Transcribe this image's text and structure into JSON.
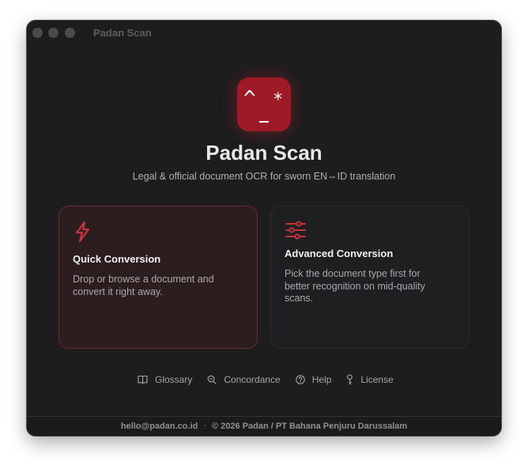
{
  "window": {
    "title": "Padan Scan"
  },
  "app": {
    "name": "Padan Scan",
    "tagline": "Legal & official document OCR for sworn EN⇔ID translation",
    "icon": {
      "name": "padan-logo",
      "glyph_left": "^",
      "glyph_right": "*",
      "color": "#9e1a27"
    }
  },
  "cards": {
    "quick": {
      "title": "Quick Conversion",
      "description": "Drop or browse a document and convert it right away.",
      "icon": "lightning-bolt-icon",
      "selected": true
    },
    "advanced": {
      "title": "Advanced Conversion",
      "description": "Pick the document type first for better recognition on mid-quality scans.",
      "icon": "sliders-icon",
      "selected": false
    }
  },
  "links": {
    "glossary": {
      "label": "Glossary",
      "icon": "book-icon"
    },
    "concordance": {
      "label": "Concordance",
      "icon": "magnifier-icon"
    },
    "help": {
      "label": "Help",
      "icon": "question-circle-icon"
    },
    "license": {
      "label": "License",
      "icon": "key-icon"
    }
  },
  "footer": {
    "email": "hello@padan.co.id",
    "separator": "·",
    "copyright": "© 2026 Padan / PT Bahana Penjuru Darussalam"
  },
  "colors": {
    "accent": "#c8323c",
    "window_bg": "#1d1d1e"
  }
}
